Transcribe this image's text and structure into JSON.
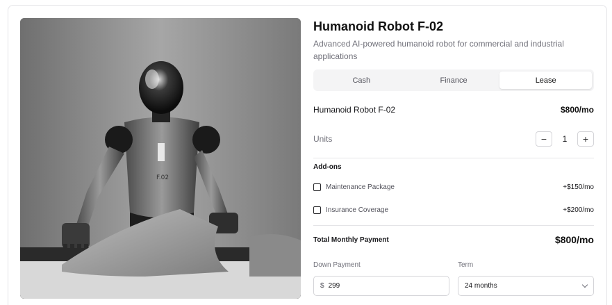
{
  "product": {
    "title": "Humanoid Robot F-02",
    "subtitle": "Advanced AI-powered humanoid robot for commercial and industrial applications",
    "image_alt": "Humanoid robot folding laundry",
    "robot_chest_text": "F.02"
  },
  "tabs": [
    {
      "label": "Cash",
      "active": false
    },
    {
      "label": "Finance",
      "active": false
    },
    {
      "label": "Lease",
      "active": true
    }
  ],
  "line_item": {
    "name": "Humanoid Robot F-02",
    "price": "$800/mo"
  },
  "units": {
    "label": "Units",
    "value": "1",
    "decrement": "−",
    "increment": "+"
  },
  "addons": {
    "heading": "Add-ons",
    "items": [
      {
        "label": "Maintenance Package",
        "price": "+$150/mo",
        "checked": false
      },
      {
        "label": "Insurance Coverage",
        "price": "+$200/mo",
        "checked": false
      }
    ]
  },
  "total": {
    "label": "Total Monthly Payment",
    "value": "$800/mo"
  },
  "down_payment": {
    "label": "Down Payment",
    "prefix": "$",
    "value": "299"
  },
  "term": {
    "label": "Term",
    "value": "24 months",
    "icon": "chevron-down-icon"
  }
}
